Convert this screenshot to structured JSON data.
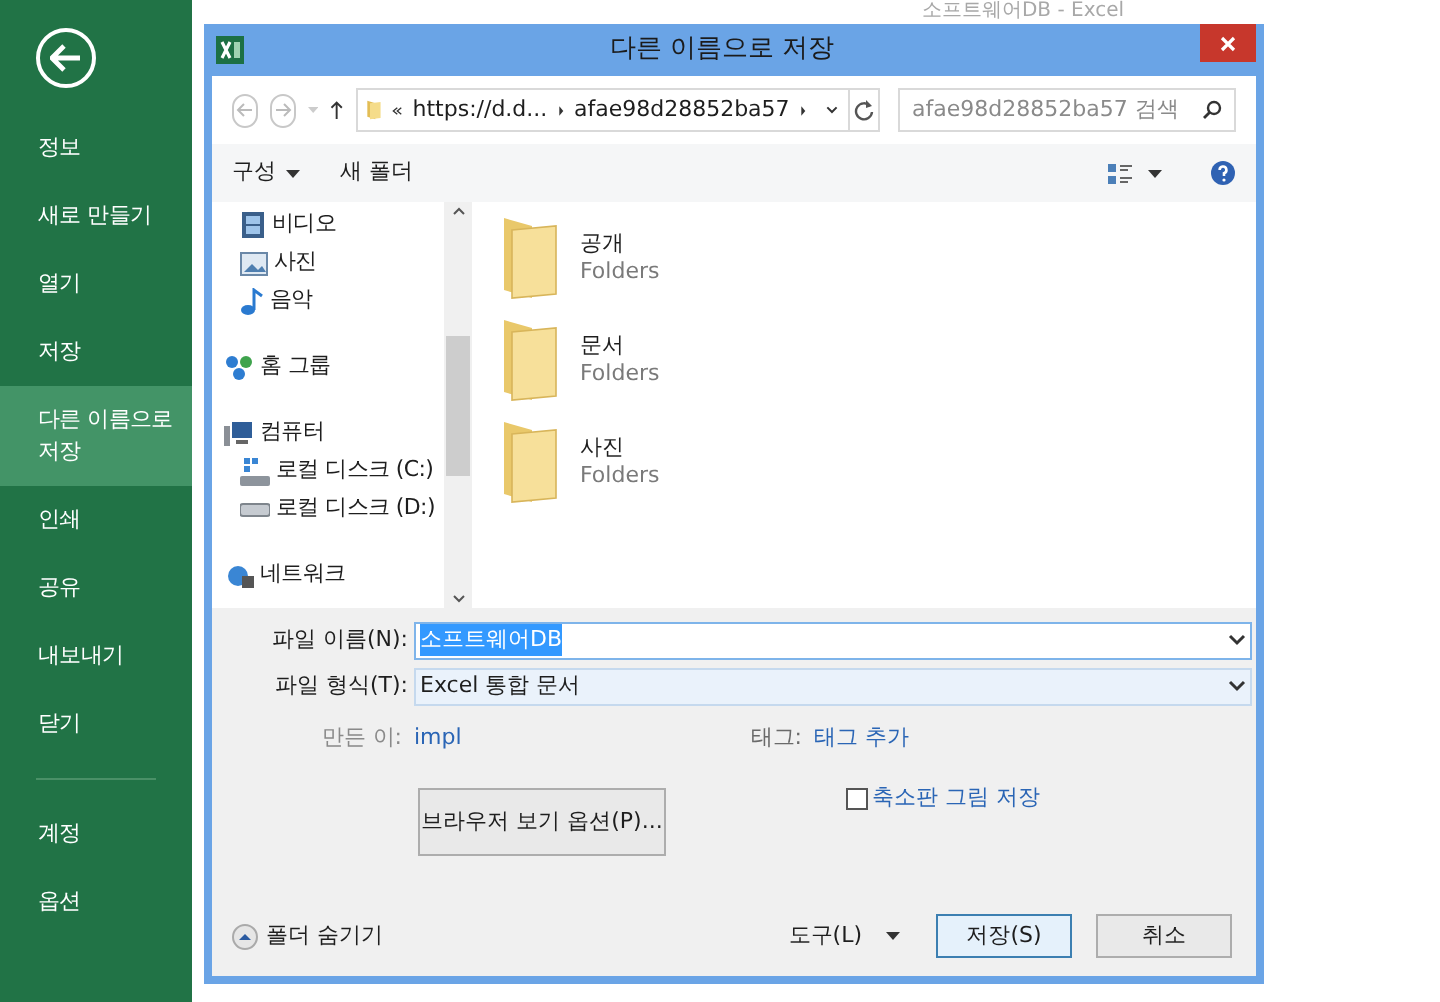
{
  "app_title": "소프트웨어DB - Excel",
  "sidebar": {
    "items": [
      {
        "label": "정보",
        "selected": false,
        "kind": "item"
      },
      {
        "label": "새로 만들기",
        "selected": false,
        "kind": "item"
      },
      {
        "label": "열기",
        "selected": false,
        "kind": "item"
      },
      {
        "label": "저장",
        "selected": false,
        "kind": "item"
      },
      {
        "label": "다른 이름으로 저장",
        "selected": true,
        "kind": "item"
      },
      {
        "label": "인쇄",
        "selected": false,
        "kind": "item"
      },
      {
        "label": "공유",
        "selected": false,
        "kind": "item"
      },
      {
        "label": "내보내기",
        "selected": false,
        "kind": "item"
      },
      {
        "label": "닫기",
        "selected": false,
        "kind": "item"
      },
      {
        "label": "계정",
        "selected": false,
        "kind": "after_divider"
      },
      {
        "label": "옵션",
        "selected": false,
        "kind": "item"
      }
    ]
  },
  "dialog": {
    "title": "다른 이름으로 저장",
    "address": {
      "segments": [
        "https://d.d...",
        "afae98d28852ba57"
      ]
    },
    "search": {
      "placeholder": "afae98d28852ba57 검색"
    },
    "toolbar": {
      "organize": "구성",
      "new_folder": "새 폴더"
    },
    "nav": {
      "items": [
        {
          "label": "비디오",
          "kind": "video"
        },
        {
          "label": "사진",
          "kind": "picture"
        },
        {
          "label": "음악",
          "kind": "music"
        },
        {
          "label": "홈 그룹",
          "kind": "homegroup"
        },
        {
          "label": "컴퓨터",
          "kind": "computer",
          "children": [
            {
              "label": "로컬 디스크 (C:)",
              "kind": "system_drive"
            },
            {
              "label": "로컬 디스크 (D:)",
              "kind": "drive"
            }
          ]
        },
        {
          "label": "네트워크",
          "kind": "network"
        }
      ]
    },
    "folders": [
      {
        "name": "공개",
        "type": "Folders"
      },
      {
        "name": "문서",
        "type": "Folders"
      },
      {
        "name": "사진",
        "type": "Folders"
      }
    ],
    "file_name": {
      "label": "파일 이름(N):",
      "value": "소프트웨어DB",
      "selected": true
    },
    "file_type": {
      "label": "파일 형식(T):",
      "value": "Excel 통합 문서"
    },
    "author": {
      "label": "만든 이:",
      "value": "impl"
    },
    "tags": {
      "label": "태그:",
      "value": "태그 추가"
    },
    "browser_options": "브라우저 보기 옵션(P)...",
    "thumbnail": {
      "label": "축소판 그림 저장",
      "checked": false
    },
    "hide_folders": "폴더 숨기기",
    "tools": "도구(L)",
    "save": "저장(S)",
    "cancel": "취소"
  }
}
